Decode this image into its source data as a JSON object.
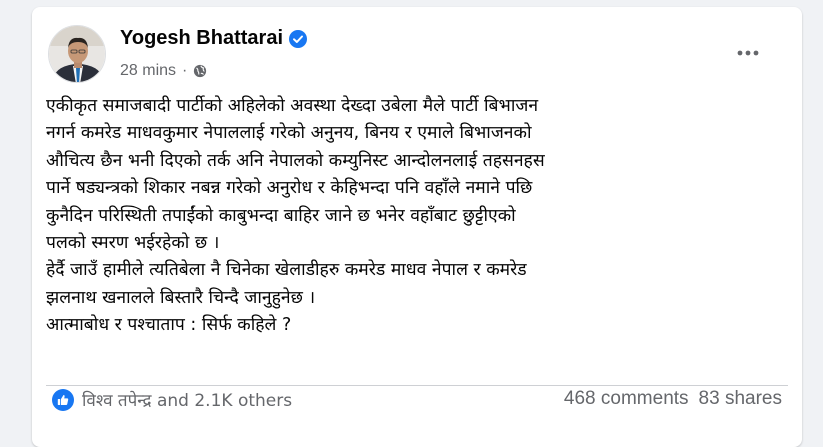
{
  "post": {
    "author": "Yogesh Bhattarai",
    "time": "28 mins",
    "separator": "·",
    "lines": [
      "एकीकृत समाजबादी पार्टीको अहिलेको अवस्था देख्दा उबेला मैले पार्टी बिभाजन",
      "नगर्न कमरेड माधवकुमार नेपाललाई गरेको अनुनय, बिनय र एमाले बिभाजनको",
      "औचित्य छैन भनी दिएको तर्क अनि  नेपालको कम्युनिस्ट आन्दोलनलाई तहसनहस",
      "पार्ने षड्यन्त्रको शिकार नबन्न गरेको अनुरोध र केहिभन्दा पनि वहाँले नमाने पछि",
      "कुनैदिन परिस्थिती तपाईंको काबुभन्दा बाहिर जाने छ भनेर वहाँबाट छुट्टीएको",
      "पलको स्मरण भईरहेको छ ।",
      "हेर्दै जाउँ हामीले त्यतिबेला नै चिनेका खेलाडीहरु कमरेड माधव नेपाल र कमरेड",
      "झलनाथ खनालले बिस्तारै चिन्दै जानुहुनेछ ।",
      "आत्माबोध र पश्चाताप : सिर्फ कहिले ?"
    ]
  },
  "footer": {
    "reactions": "विश्व तपेन्द्र and 2.1K others",
    "comments": "468 comments",
    "shares": "83 shares"
  },
  "colors": {
    "accent": "#1877f2",
    "secondary_text": "#65676b"
  },
  "icons": {
    "verified": "verified-badge-icon",
    "audience": "globe-icon",
    "more": "more-horizontal-icon",
    "reaction": "like-icon"
  }
}
